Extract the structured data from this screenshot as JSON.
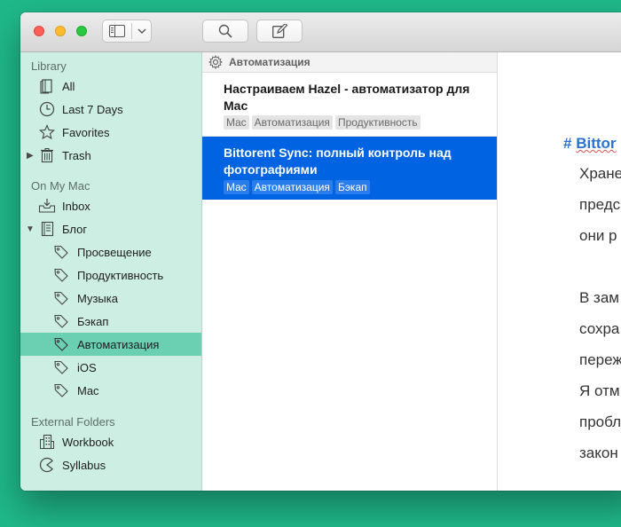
{
  "toolbar": {
    "sidebar_toggle_icon": "sidebar-icon",
    "chevron_icon": "chevron-down-icon",
    "search_icon": "search-icon",
    "compose_icon": "compose-icon"
  },
  "sidebar": {
    "library_header": "Library",
    "library_items": [
      {
        "label": "All",
        "icon": "books-icon"
      },
      {
        "label": "Last 7 Days",
        "icon": "clock-icon"
      },
      {
        "label": "Favorites",
        "icon": "star-icon"
      },
      {
        "label": "Trash",
        "icon": "trash-icon"
      }
    ],
    "mac_header": "On My Mac",
    "mac_items": [
      {
        "label": "Inbox",
        "icon": "inbox-icon"
      },
      {
        "label": "Блог",
        "icon": "notebook-icon"
      }
    ],
    "tags": [
      {
        "label": "Просвещение"
      },
      {
        "label": "Продуктивность"
      },
      {
        "label": "Музыка"
      },
      {
        "label": "Бэкап"
      },
      {
        "label": "Автоматизация",
        "selected": true
      },
      {
        "label": "iOS"
      },
      {
        "label": "Mac"
      }
    ],
    "external_header": "External Folders",
    "external_items": [
      {
        "label": "Workbook",
        "icon": "building-icon"
      },
      {
        "label": "Syllabus",
        "icon": "pacman-icon"
      }
    ]
  },
  "list": {
    "header": "Автоматизация",
    "notes": [
      {
        "title": "Настраиваем Hazel - автоматизатор для Mac",
        "tags": [
          "Mac",
          "Автоматизация",
          "Продуктивность"
        ]
      },
      {
        "title": "Bittorent Sync: полный контроль над фотографиями",
        "tags": [
          "Mac",
          "Автоматизация",
          "Бэкап"
        ],
        "active": true
      }
    ]
  },
  "editor": {
    "heading_hash": "#",
    "heading_text": "Bittor",
    "lines": [
      "Хране",
      "предс",
      "они р",
      "В зам",
      "сохра",
      "переж",
      "Я отм",
      "пробл",
      "закон"
    ]
  },
  "colors": {
    "accent": "#0063e1",
    "sidebar_bg": "#cdeee2",
    "sidebar_selected": "#6bcfb1",
    "heading": "#2a71d0",
    "desktop": "#1fb889"
  }
}
